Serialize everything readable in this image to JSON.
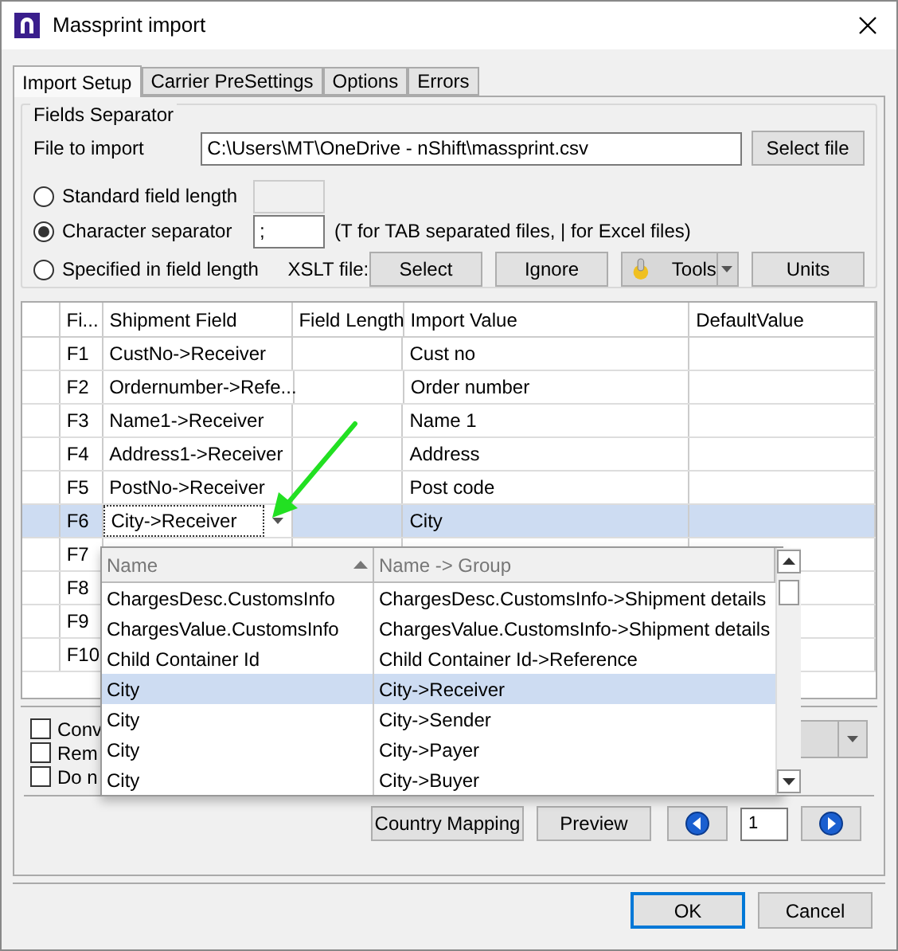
{
  "window": {
    "title": "Massprint import"
  },
  "tabs": [
    {
      "label": "Import Setup",
      "selected": true
    },
    {
      "label": "Carrier PreSettings",
      "selected": false
    },
    {
      "label": "Options",
      "selected": false
    },
    {
      "label": "Errors",
      "selected": false
    }
  ],
  "fields_separator": {
    "title": "Fields Separator",
    "file_label": "File to import",
    "file_value": "C:\\Users\\MT\\OneDrive - nShift\\massprint.csv",
    "select_file": "Select file",
    "radios": [
      {
        "label": "Standard field length",
        "selected": false
      },
      {
        "label": "Character separator",
        "selected": true
      },
      {
        "label": "Specified in field length",
        "selected": false
      }
    ],
    "separator_value": ";",
    "separator_hint": "(T for TAB separated files, | for Excel files)",
    "xslt_label": "XSLT file:",
    "xslt_buttons": [
      "Select",
      "Ignore"
    ],
    "tools": "Tools",
    "units": "Units"
  },
  "grid": {
    "columns": [
      "Fi...",
      "Shipment Field",
      "Field Length",
      "Import Value",
      "DefaultValue"
    ],
    "rows": [
      {
        "field": "F1",
        "shipment_field": "CustNo->Receiver",
        "import_value": "Cust no",
        "selected": false
      },
      {
        "field": "F2",
        "shipment_field": "Ordernumber->Refe...",
        "import_value": "Order number",
        "selected": false
      },
      {
        "field": "F3",
        "shipment_field": "Name1->Receiver",
        "import_value": "Name 1",
        "selected": false
      },
      {
        "field": "F4",
        "shipment_field": "Address1->Receiver",
        "import_value": "Address",
        "selected": false
      },
      {
        "field": "F5",
        "shipment_field": "PostNo->Receiver",
        "import_value": "Post code",
        "selected": false
      },
      {
        "field": "F6",
        "shipment_field": "City->Receiver",
        "import_value": "City",
        "selected": true
      },
      {
        "field": "F7",
        "selected": false
      },
      {
        "field": "F8",
        "selected": false
      },
      {
        "field": "F9",
        "selected": false
      },
      {
        "field": "F10",
        "selected": false
      }
    ]
  },
  "dropdown": {
    "columns": [
      "Name",
      "Name -> Group"
    ],
    "rows": [
      {
        "name": "ChargesDesc.CustomsInfo",
        "group": "ChargesDesc.CustomsInfo->Shipment details",
        "selected": false
      },
      {
        "name": "ChargesValue.CustomsInfo",
        "group": "ChargesValue.CustomsInfo->Shipment details",
        "selected": false
      },
      {
        "name": "Child Container Id",
        "group": "Child Container Id->Reference",
        "selected": false
      },
      {
        "name": "City",
        "group": "City->Receiver",
        "selected": true
      },
      {
        "name": "City",
        "group": "City->Sender",
        "selected": false
      },
      {
        "name": "City",
        "group": "City->Payer",
        "selected": false
      },
      {
        "name": "City",
        "group": "City->Buyer",
        "selected": false
      }
    ]
  },
  "options": [
    {
      "label": "Conv",
      "checked": false
    },
    {
      "label": "Rem",
      "checked": false
    },
    {
      "label": "Do n",
      "checked": false
    }
  ],
  "bottom_buttons": [
    "Country Mapping",
    "Preview"
  ],
  "page": "1",
  "dialog_buttons": [
    {
      "label": "OK",
      "default": true
    },
    {
      "label": "Cancel",
      "default": false
    }
  ]
}
